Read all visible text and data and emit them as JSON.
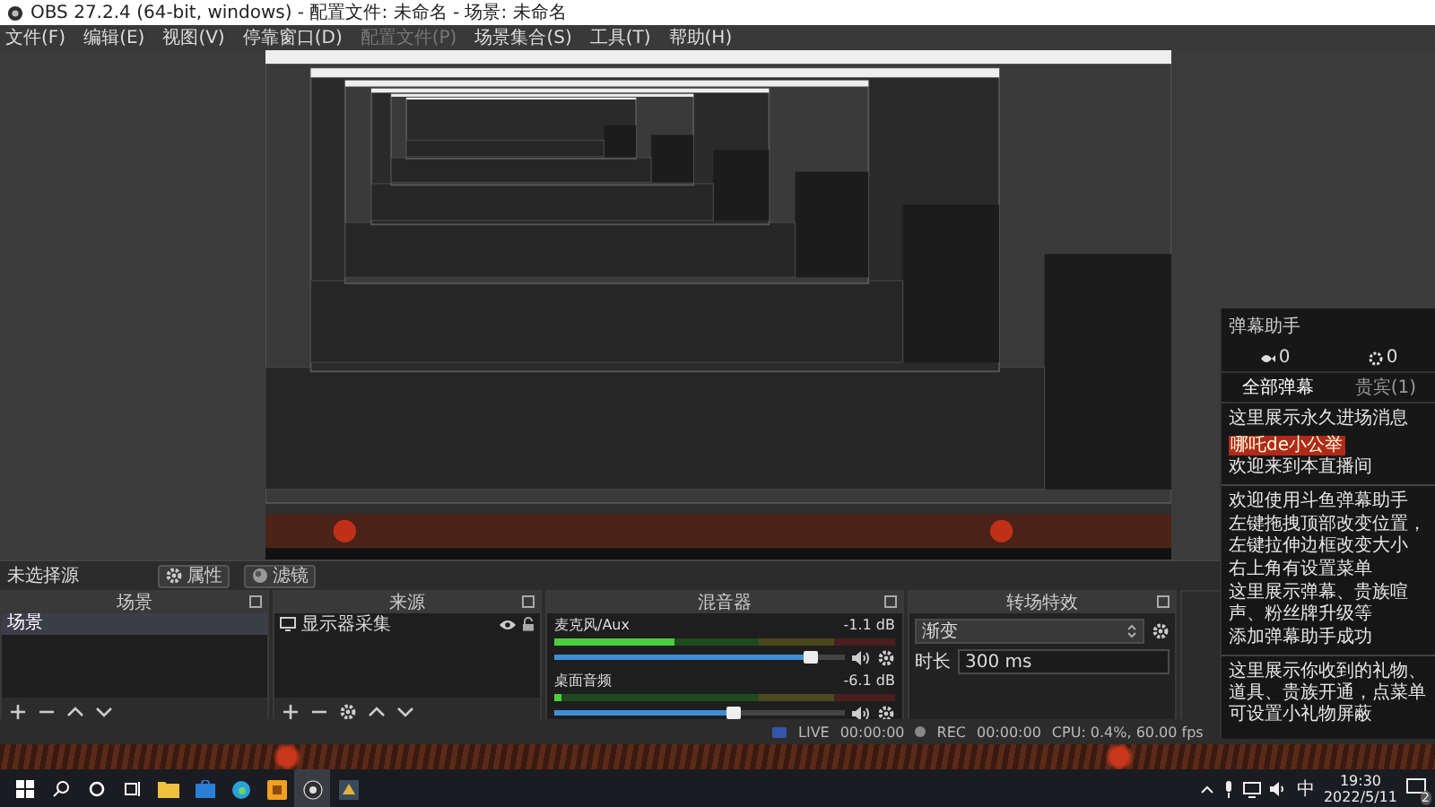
{
  "window": {
    "title": "OBS 27.2.4 (64-bit, windows) - 配置文件: 未命名 - 场景: 未命名"
  },
  "menu": [
    {
      "label": "文件(F)",
      "disabled": false
    },
    {
      "label": "编辑(E)",
      "disabled": false
    },
    {
      "label": "视图(V)",
      "disabled": false
    },
    {
      "label": "停靠窗口(D)",
      "disabled": false
    },
    {
      "label": "配置文件(P)",
      "disabled": true
    },
    {
      "label": "场景集合(S)",
      "disabled": false
    },
    {
      "label": "工具(T)",
      "disabled": false
    },
    {
      "label": "帮助(H)",
      "disabled": false
    }
  ],
  "source_toolbar": {
    "label": "未选择源",
    "buttons": [
      {
        "label": "属性",
        "kind": "gear"
      },
      {
        "label": "滤镜",
        "kind": "filter"
      }
    ]
  },
  "scenes": {
    "title": "场景",
    "items": [
      {
        "label": "场景",
        "selected": true
      }
    ]
  },
  "sources": {
    "title": "来源",
    "items": [
      {
        "label": "显示器采集",
        "visible": true,
        "locked": false
      }
    ]
  },
  "mixer": {
    "title": "混音器",
    "channels": [
      {
        "name": "麦克风/Aux",
        "reading": "-1.1 dB",
        "meter": {
          "level": 0.35
        },
        "fader": {
          "level": 0.88
        }
      },
      {
        "name": "桌面音频",
        "reading": "-6.1 dB",
        "meter": {
          "level": 0.02
        },
        "fader": {
          "level": 0.62
        }
      }
    ]
  },
  "transitions": {
    "title": "转场特效",
    "transition": "渐变",
    "duration_label": "时长",
    "duration": "300 ms"
  },
  "status": {
    "live": "LIVE",
    "live_time": "00:00:00",
    "rec": "REC",
    "rec_time": "00:00:00",
    "cpu": "CPU: 0.4%, 60.00 fps"
  },
  "chat_overlay": {
    "title": "弹幕助手",
    "counters": [
      "0",
      "0"
    ],
    "tabs": [
      {
        "label": "全部弹幕",
        "selected": true
      },
      {
        "label": "贵宾(1)",
        "selected": false
      }
    ],
    "entry_message": "这里展示永久进场消息",
    "entrant": {
      "name": "哪吒de小公举",
      "text": "欢迎来到本直播间"
    },
    "notices": [
      "欢迎使用斗鱼弹幕助手",
      "左键拖拽顶部改变位置，左键拉伸边框改变大小",
      "右上角有设置菜单",
      "这里展示弹幕、贵族喧声、粉丝牌升级等",
      "添加弹幕助手成功"
    ],
    "gift_notice": "这里展示你收到的礼物、道具、贵族开通，点菜单可设置小礼物屏蔽"
  },
  "taskbar": {
    "ime": "中",
    "time": "19:30",
    "date": "2022/5/11",
    "notifications": "2"
  }
}
